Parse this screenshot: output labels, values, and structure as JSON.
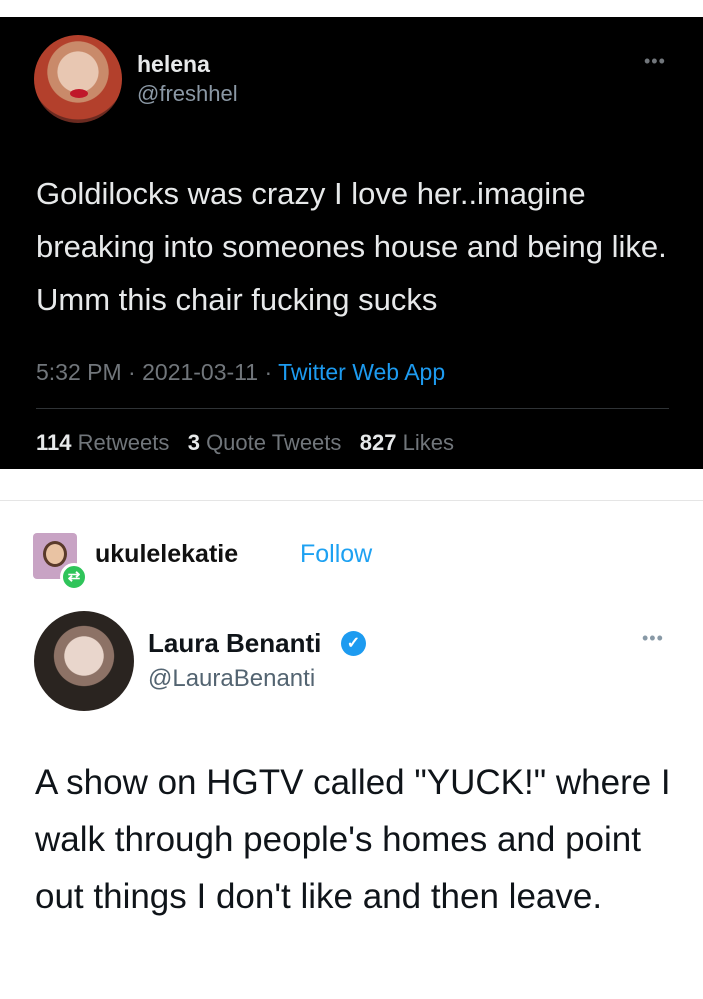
{
  "tweet1": {
    "display_name": "helena",
    "handle": "@freshhel",
    "more_icon": "more-dots-icon",
    "text": "Goldilocks was crazy I love her..imagine breaking into someones house and being like. Umm this chair fucking sucks",
    "time": "5:32 PM",
    "date": "2021-03-11",
    "source": "Twitter Web App",
    "retweets_count": "114",
    "retweets_label": "Retweets",
    "quotes_count": "3",
    "quotes_label": "Quote Tweets",
    "likes_count": "827",
    "likes_label": "Likes",
    "colors": {
      "background": "#000000",
      "link": "#1d9bf0",
      "muted": "#71767b"
    }
  },
  "reblog": {
    "username": "ukulelekatie",
    "follow_label": "Follow",
    "badge_icon": "reblog-icon",
    "colors": {
      "follow": "#1da1f2",
      "badge": "#2fc45a"
    }
  },
  "tweet2": {
    "display_name": "Laura Benanti",
    "verified_icon": "verified-badge-icon",
    "handle": "@LauraBenanti",
    "more_icon": "more-dots-icon",
    "text": "A show on HGTV called \"YUCK!\" where I walk through people's homes and point out things I don't like and then leave.",
    "colors": {
      "verified": "#1d9bf0"
    }
  }
}
